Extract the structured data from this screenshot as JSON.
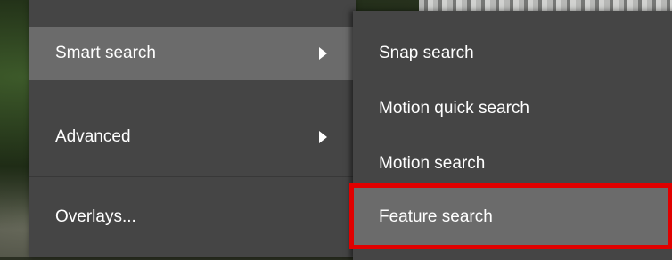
{
  "menu": {
    "items": [
      {
        "label": "Smart search",
        "has_submenu": true,
        "active": true
      },
      {
        "label": "Advanced",
        "has_submenu": true,
        "active": false
      },
      {
        "label": "Overlays...",
        "has_submenu": false,
        "active": false
      }
    ]
  },
  "submenu": {
    "items": [
      {
        "label": "Snap search",
        "active": false
      },
      {
        "label": "Motion quick search",
        "active": false
      },
      {
        "label": "Motion search",
        "active": false
      },
      {
        "label": "Feature search",
        "active": true,
        "highlighted": true
      }
    ]
  },
  "colors": {
    "menu_bg": "#454545",
    "active_bg": "#6b6b6b",
    "highlight": "#e00000",
    "text": "#ffffff"
  },
  "icons": {
    "submenu_arrow": "submenu-arrow-icon"
  }
}
